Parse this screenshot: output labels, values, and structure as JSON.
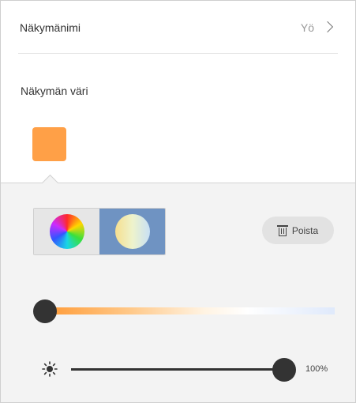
{
  "scene_name": {
    "label": "Näkymänimi",
    "value": "Yö"
  },
  "scene_color": {
    "label": "Näkymän väri",
    "swatch": "#ffa047"
  },
  "color_modes": {
    "items": [
      {
        "id": "color-wheel",
        "icon": "color-wheel-icon",
        "active": false
      },
      {
        "id": "white-temperature",
        "icon": "white-temperature-icon",
        "active": true
      }
    ]
  },
  "actions": {
    "delete_label": "Poista"
  },
  "temperature": {
    "level": 0
  },
  "brightness": {
    "value": 100,
    "label": "100%"
  },
  "colors": {
    "accent": "#6f93c2",
    "panel": "#f3f3f3",
    "knob": "#333333"
  }
}
